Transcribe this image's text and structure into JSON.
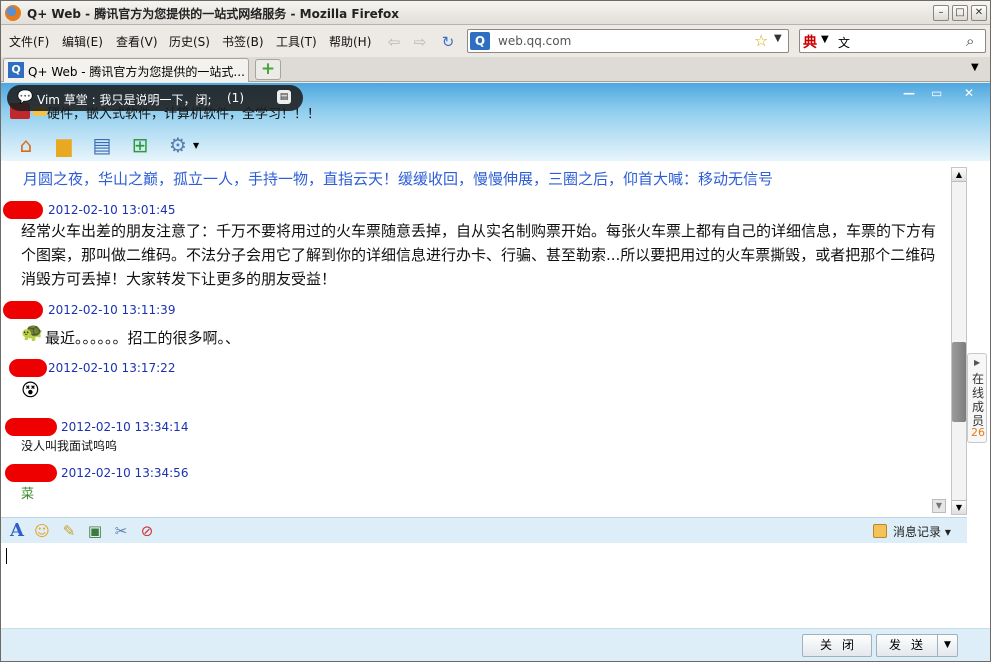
{
  "browser": {
    "window_title": "Q+ Web - 腾讯官方为您提供的一站式网络服务 - Mozilla Firefox",
    "menus": [
      "文件(F)",
      "编辑(E)",
      "查看(V)",
      "历史(S)",
      "书签(B)",
      "工具(T)",
      "帮助(H)"
    ],
    "url": "web.qq.com",
    "search_engine_icon": "典",
    "search_text": "文",
    "tab_title": "Q+ Web - 腾讯官方为您提供的一站式...",
    "site_icon_letter": "Q"
  },
  "qplus": {
    "popup": {
      "text": "Vim 草堂 : 我只是说明一下，闭;",
      "count": "(1)"
    },
    "signature": "硬件，嵌入式软件，计算机软件，全学习！！！",
    "motto": "月圆之夜，华山之巅，孤立一人，手持一物，直指云天！缓缓收回，慢慢伸展，三圈之后，仰首大喊：移动无信号",
    "toolbar_icons": [
      "home-icon",
      "folder-icon",
      "contacts-icon",
      "add-app-icon",
      "settings-icon"
    ]
  },
  "messages": [
    {
      "time": "2012-02-10 13:01:45",
      "text": "经常火车出差的朋友注意了：千万不要将用过的火车票随意丢掉，自从实名制购票开始。每张火车票上都有自己的详细信息，车票的下方有个图案，那叫做二维码。不法分子会用它了解到你的详细信息进行办卡、行骗、甚至勒索...所以要把用过的火车票撕毁，或者把那个二维码消毁方可丢掉！大家转发下让更多的朋友受益！"
    },
    {
      "time": "2012-02-10 13:11:39",
      "text": "最近。。。。。。招工的很多啊。、",
      "emoji": "🐢"
    },
    {
      "time": "2012-02-10 13:17:22",
      "text": "",
      "emoji": "😵"
    },
    {
      "time": "2012-02-10 13:34:14",
      "text": "没人叫我面试呜呜"
    },
    {
      "time": "2012-02-10 13:34:56",
      "text": "菜"
    }
  ],
  "online_panel": {
    "label": "在线成员",
    "count": "26"
  },
  "input": {
    "history_label": "消息记录",
    "close_label": "关闭",
    "send_label": "发送"
  }
}
